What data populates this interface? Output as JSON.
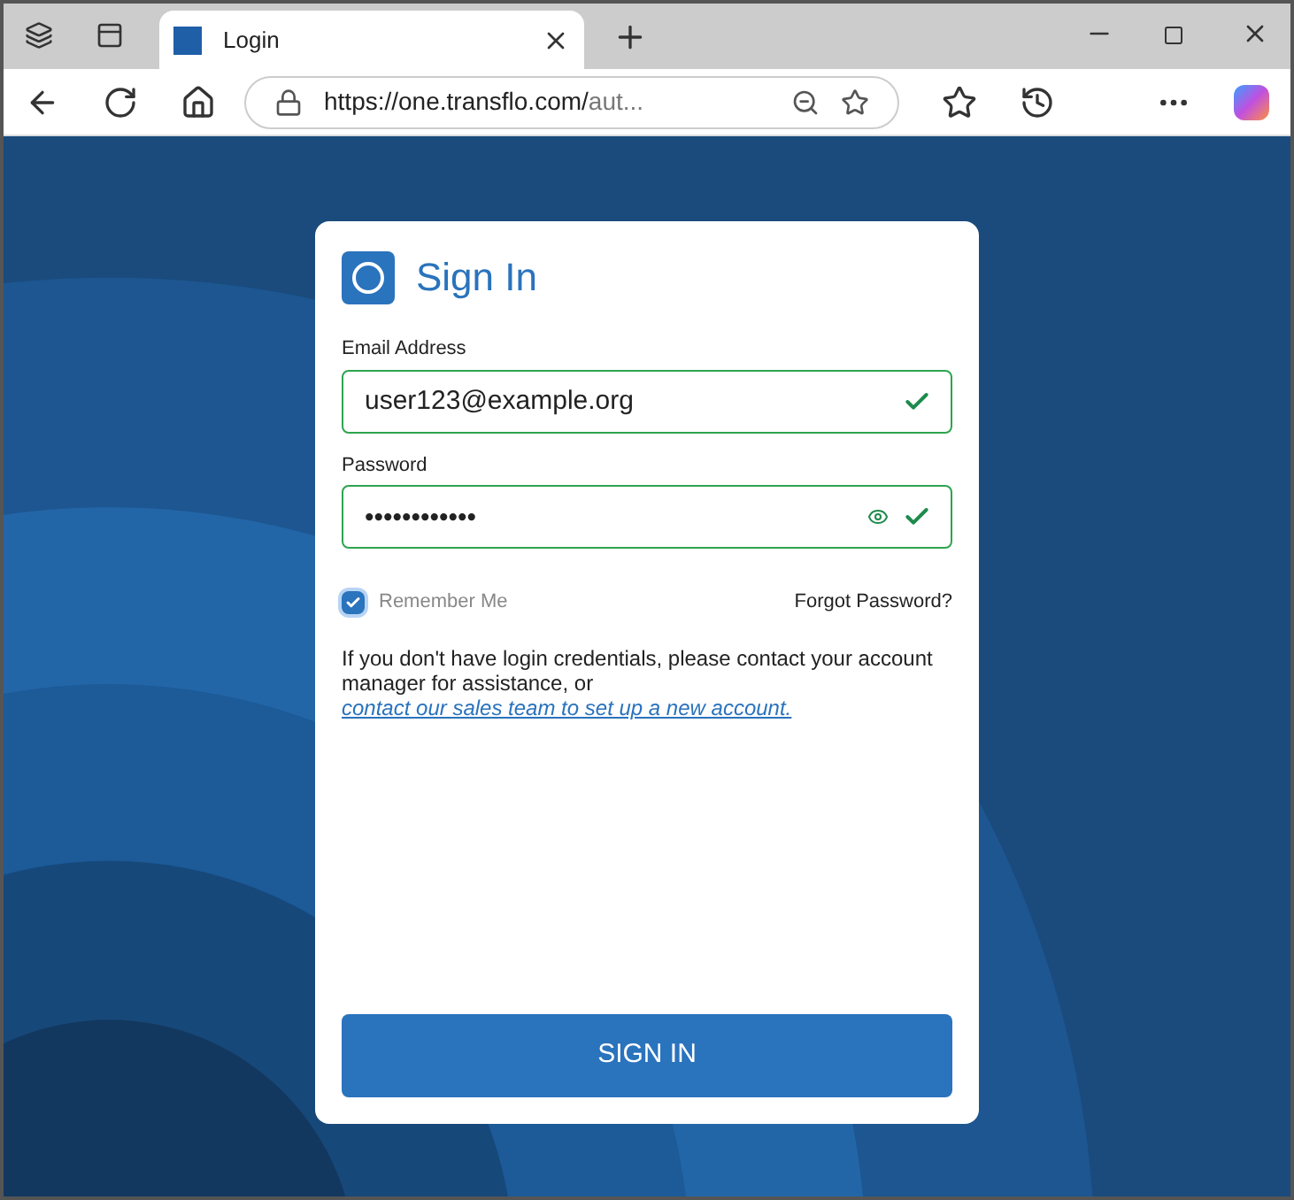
{
  "browser": {
    "tab_title": "Login",
    "url_host": "https://one.transflo.com/",
    "url_rest": "aut..."
  },
  "card": {
    "title": "Sign In",
    "fields": [
      {
        "label": "Email Address",
        "value": "user123@example.org",
        "kind": "text",
        "valid": true
      },
      {
        "label": "Password",
        "value": "••••••••••••",
        "kind": "password",
        "valid": true
      }
    ],
    "remember": {
      "label": "Remember Me",
      "checked": true
    },
    "forgot": "Forgot Password?",
    "note": "If you don't have login credentials, please contact your account manager for assistance, or",
    "link": "contact our sales team to set up a new account.",
    "button": "SIGN IN"
  }
}
